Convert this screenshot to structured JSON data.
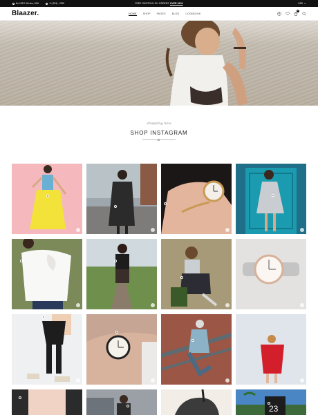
{
  "topbar": {
    "address": "No 123 E 4th Ave, USA",
    "phone": "+1 (234) - 4765",
    "promo_prefix": "FREE SHIPPING ON ORDERS",
    "promo_amount": "OVER $100",
    "currency": "USD"
  },
  "header": {
    "logo": "Blaazer.",
    "nav": [
      "HOME",
      "SHOP",
      "PAGES",
      "BLOG",
      "LOOKBOOK"
    ],
    "cart_count": "0",
    "icons": [
      "user-icon",
      "heart-icon",
      "cart-icon",
      "search-icon"
    ]
  },
  "section": {
    "script": "shopping now",
    "title": "SHOP INSTAGRAM"
  },
  "colors": {
    "topbar_bg": "#111111",
    "accent": "#111111"
  },
  "instagram": {
    "icon": "instagram-icon",
    "tiles": [
      {
        "name": "yellow-skirt-look"
      },
      {
        "name": "black-coat-look"
      },
      {
        "name": "watch-wrist"
      },
      {
        "name": "blue-door-dress"
      },
      {
        "name": "white-blouse"
      },
      {
        "name": "railway-man"
      },
      {
        "name": "denim-sitting"
      },
      {
        "name": "white-watch"
      },
      {
        "name": "black-jeans-wall"
      },
      {
        "name": "black-watch-arm"
      },
      {
        "name": "stairs-streetwear"
      },
      {
        "name": "red-sweater"
      },
      {
        "name": "pink-jacket"
      },
      {
        "name": "car-street"
      },
      {
        "name": "leather-bag"
      },
      {
        "name": "jersey-palm"
      }
    ]
  }
}
